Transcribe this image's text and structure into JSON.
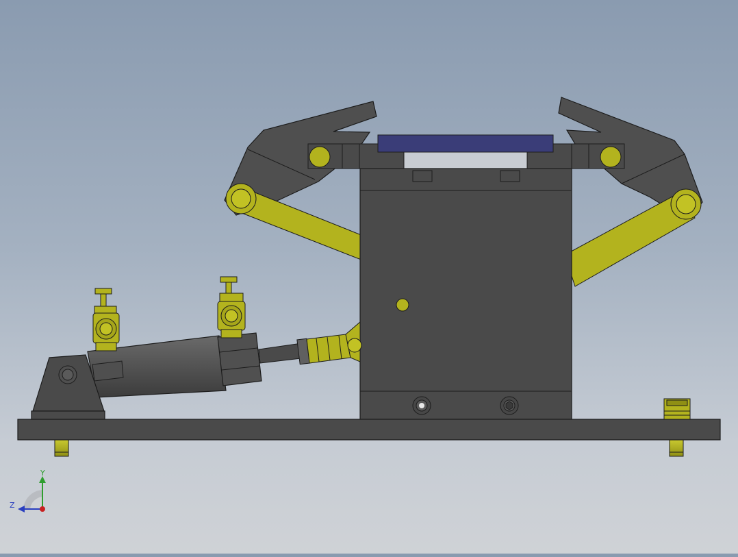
{
  "view": {
    "type": "CAD model viewport",
    "background_top": "#8a9bb0",
    "background_bottom": "#cfd2d6"
  },
  "colors": {
    "body": "#4a4a4a",
    "body_light": "#575757",
    "edge": "#1c1c1c",
    "linkage": "#b3b31e",
    "linkage_dark": "#7a7a10",
    "pad": "#3a3d78"
  },
  "triad": {
    "y_label": "Y",
    "z_label": "Z",
    "y_color": "#2e9e2e",
    "z_color": "#2a3fbf",
    "x_color": "#c82020"
  }
}
